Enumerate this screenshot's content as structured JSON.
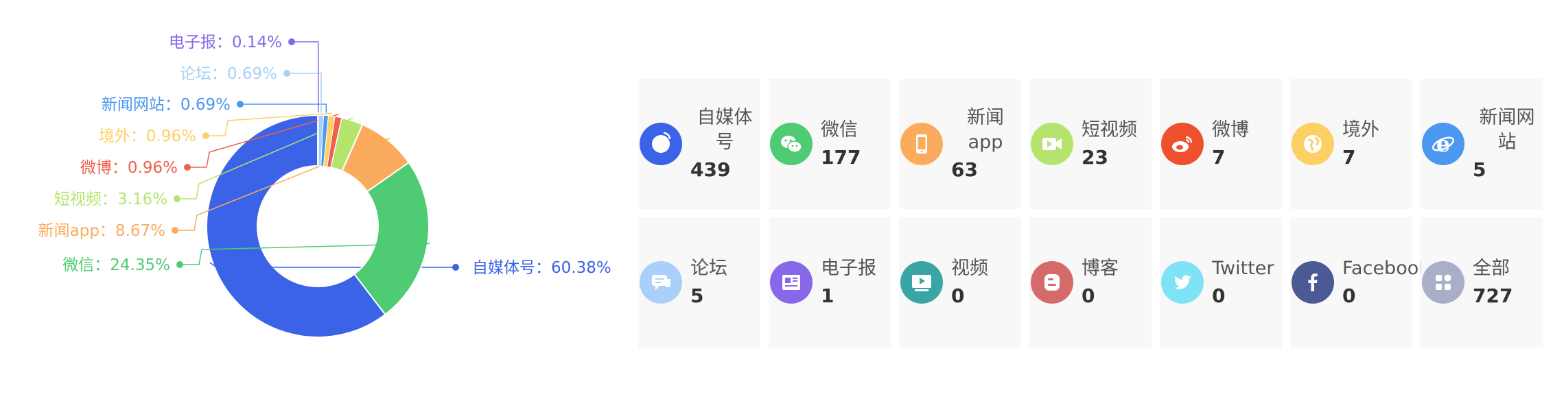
{
  "chart_data": {
    "type": "pie",
    "style": "donut",
    "separator": "：",
    "slices": [
      {
        "name": "自媒体号",
        "value": 60.38,
        "pct": "60.38%",
        "color": "#3a63e8"
      },
      {
        "name": "微信",
        "value": 24.35,
        "pct": "24.35%",
        "color": "#4ecb73"
      },
      {
        "name": "新闻app",
        "value": 8.67,
        "pct": "8.67%",
        "color": "#fbab5e"
      },
      {
        "name": "短视频",
        "value": 3.16,
        "pct": "3.16%",
        "color": "#b5e46e"
      },
      {
        "name": "微博",
        "value": 0.96,
        "pct": "0.96%",
        "color": "#f0604d"
      },
      {
        "name": "境外",
        "value": 0.96,
        "pct": "0.96%",
        "color": "#fdd066"
      },
      {
        "name": "新闻网站",
        "value": 0.69,
        "pct": "0.69%",
        "color": "#4c97f0"
      },
      {
        "name": "论坛",
        "value": 0.69,
        "pct": "0.69%",
        "color": "#a8d0f8"
      },
      {
        "name": "电子报",
        "value": 0.14,
        "pct": "0.14%",
        "color": "#8668e8"
      }
    ]
  },
  "stats": [
    {
      "label": "自媒体号",
      "value": "439",
      "color": "#3a63e8",
      "icon": "self-media-icon",
      "wrap": true
    },
    {
      "label": "微信",
      "value": "177",
      "color": "#4ecb73",
      "icon": "wechat-icon",
      "wrap": false
    },
    {
      "label": "新闻app",
      "value": "63",
      "color": "#fbab5e",
      "icon": "phone-icon",
      "wrap": true
    },
    {
      "label": "短视频",
      "value": "23",
      "color": "#b5e46e",
      "icon": "video-camera-icon",
      "wrap": false
    },
    {
      "label": "微博",
      "value": "7",
      "color": "#f0502d",
      "icon": "weibo-icon",
      "wrap": false
    },
    {
      "label": "境外",
      "value": "7",
      "color": "#fdd066",
      "icon": "globe-icon",
      "wrap": false
    },
    {
      "label": "新闻网站",
      "value": "5",
      "color": "#4c97f0",
      "icon": "browser-e-icon",
      "wrap": true
    },
    {
      "label": "论坛",
      "value": "5",
      "color": "#a8d0f8",
      "icon": "forum-chat-icon",
      "wrap": false
    },
    {
      "label": "电子报",
      "value": "1",
      "color": "#8668e8",
      "icon": "newspaper-icon",
      "wrap": false
    },
    {
      "label": "视频",
      "value": "0",
      "color": "#3aa5a5",
      "icon": "play-screen-icon",
      "wrap": false
    },
    {
      "label": "博客",
      "value": "0",
      "color": "#d46a6a",
      "icon": "blogger-icon",
      "wrap": false
    },
    {
      "label": "Twitter",
      "value": "0",
      "color": "#7de3f5",
      "icon": "twitter-icon",
      "wrap": false
    },
    {
      "label": "Facebook",
      "value": "0",
      "color": "#4b5a94",
      "icon": "facebook-icon",
      "wrap": false
    },
    {
      "label": "全部",
      "value": "727",
      "color": "#a9aec9",
      "icon": "grid-all-icon",
      "wrap": false
    }
  ]
}
